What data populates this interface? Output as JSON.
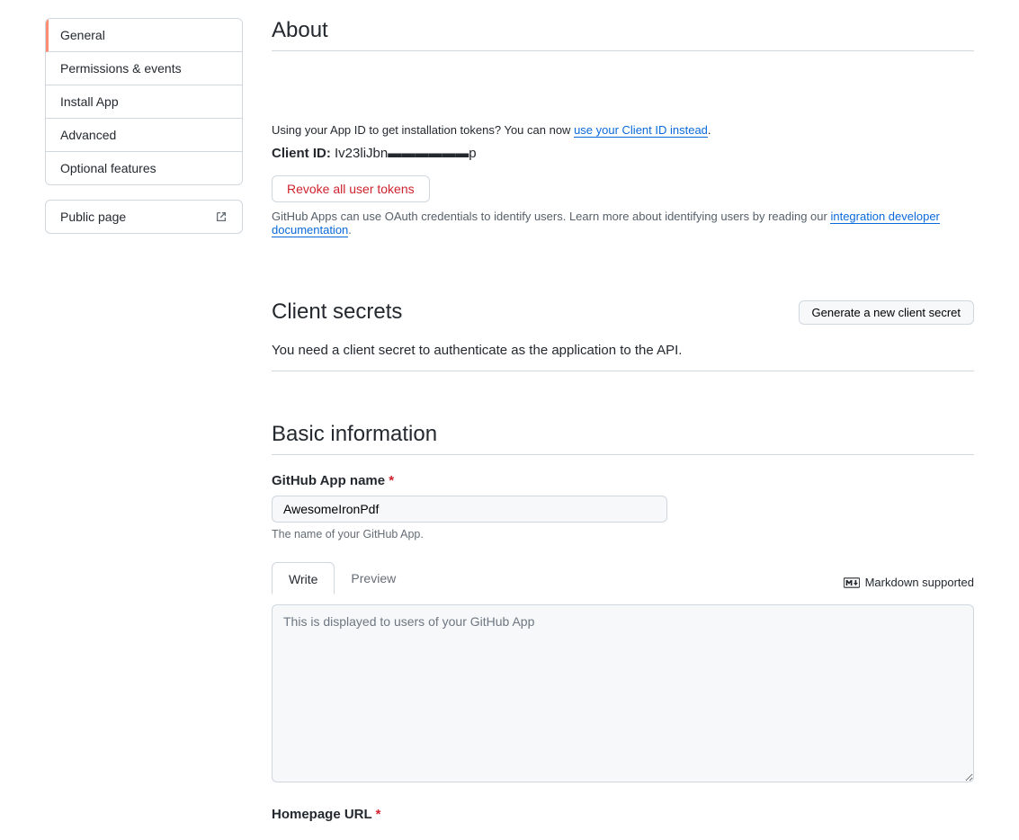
{
  "sidebar": {
    "items": [
      {
        "label": "General"
      },
      {
        "label": "Permissions & events"
      },
      {
        "label": "Install App"
      },
      {
        "label": "Advanced"
      },
      {
        "label": "Optional features"
      }
    ],
    "public_page": "Public page"
  },
  "about": {
    "heading": "About",
    "token_notice_pre": "Using your App ID to get installation tokens? You can now ",
    "token_notice_link": "use your Client ID instead",
    "token_notice_post": ".",
    "client_id_label": "Client ID:",
    "client_id_value": "Iv23liJbn▬▬▬▬▬▬p",
    "revoke_label": "Revoke all user tokens",
    "oauth_help_pre": "GitHub Apps can use OAuth credentials to identify users. Learn more about identifying users by reading our ",
    "oauth_help_link": "integration developer documentation",
    "oauth_help_post": "."
  },
  "client_secrets": {
    "heading": "Client secrets",
    "generate_label": "Generate a new client secret",
    "description": "You need a client secret to authenticate as the application to the API."
  },
  "basic_info": {
    "heading": "Basic information",
    "app_name_label": "GitHub App name",
    "app_name_value": "AwesomeIronPdf",
    "app_name_help": "The name of your GitHub App.",
    "tabs": {
      "write": "Write",
      "preview": "Preview"
    },
    "markdown_hint": "Markdown supported",
    "description_placeholder": "This is displayed to users of your GitHub App",
    "homepage_label": "Homepage URL"
  }
}
